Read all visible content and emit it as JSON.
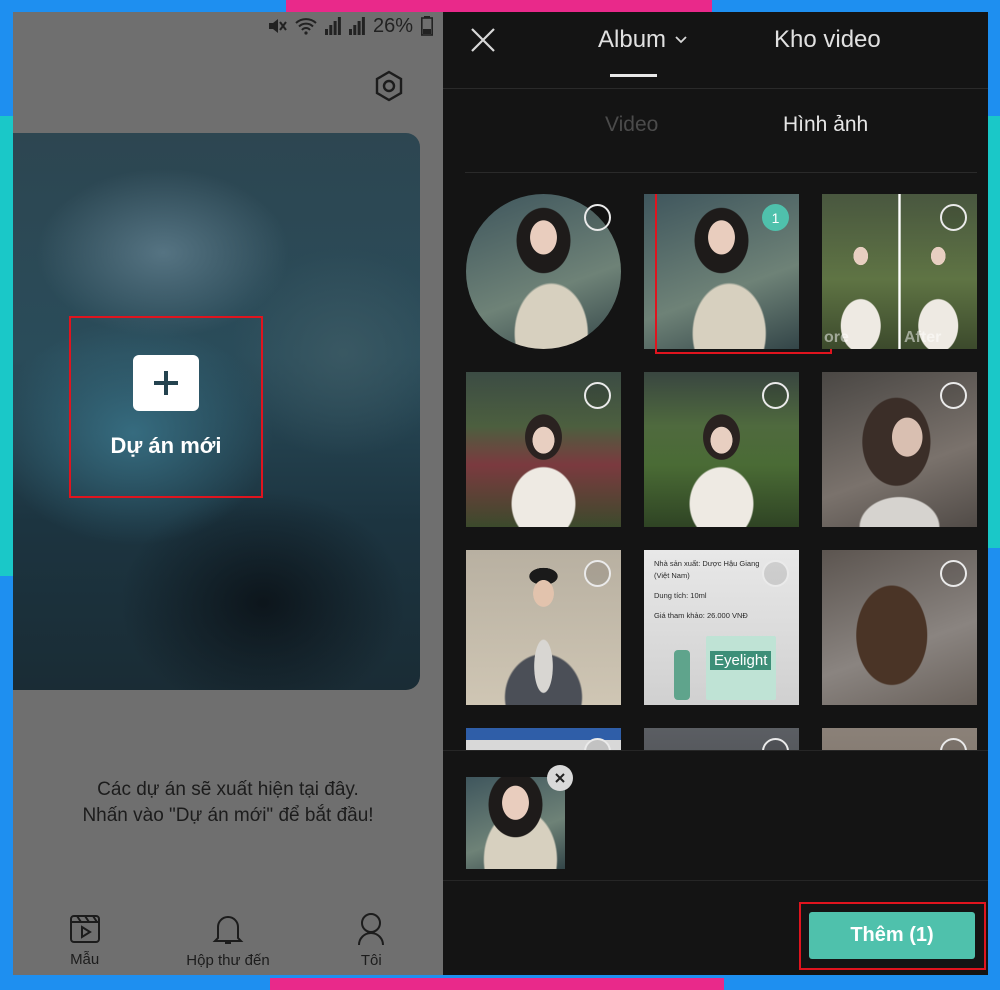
{
  "colors": {
    "accent": "#4fc1ac",
    "highlight": "#e0141e",
    "frame_blue": "#1e8ff0",
    "frame_cyan": "#1ac8c8",
    "frame_pink": "#e9298a"
  },
  "left_screen": {
    "status": {
      "battery": "26%",
      "icons": [
        "mute-icon",
        "wifi-icon",
        "signal-icon",
        "signal-icon"
      ]
    },
    "settings_icon": "settings-hex-icon",
    "new_project_label": "Dự án mới",
    "empty_state_line1": "Các dự án sẽ xuất hiện tại đây.",
    "empty_state_line2": "Nhấn vào \"Dự án mới\" để bắt đầu!",
    "nav": [
      {
        "label": "Mẫu",
        "icon": "template-play-icon"
      },
      {
        "label": "Hộp thư đến",
        "icon": "bell-icon"
      },
      {
        "label": "Tôi",
        "icon": "user-icon"
      }
    ]
  },
  "right_screen": {
    "tabs": {
      "album": "Album",
      "stock": "Kho video"
    },
    "sub_tabs": {
      "video": "Video",
      "photo": "Hình ảnh"
    },
    "selected_index_badge": "1",
    "grid_overlay_text": {
      "split_before": "ore",
      "split_after": "After"
    },
    "doc_thumb": {
      "line1": "Nhà sản xuất: Dược Hậu Giang (Việt Nam)",
      "line2": "Dung tích: 10ml",
      "line3": "Giá tham khảo: 26.000 VNĐ",
      "brand": "Eyelight"
    },
    "add_button": "Thêm (1)"
  }
}
